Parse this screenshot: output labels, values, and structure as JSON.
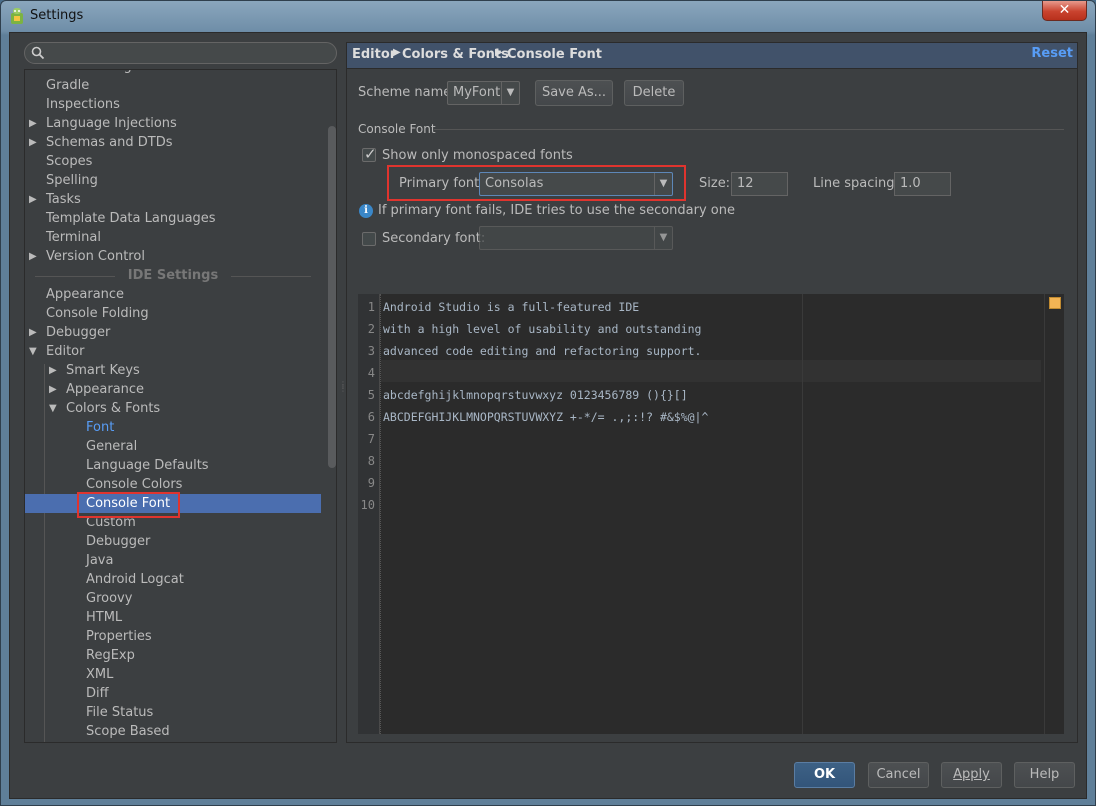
{
  "window": {
    "title": "Settings",
    "close_glyph": "✕"
  },
  "search": {
    "placeholder": ""
  },
  "tree": {
    "items": [
      {
        "label": "File Encodings",
        "level": 1,
        "arrow": ""
      },
      {
        "label": "Gradle",
        "level": 1,
        "arrow": ""
      },
      {
        "label": "Inspections",
        "level": 1,
        "arrow": ""
      },
      {
        "label": "Language Injections",
        "level": 1,
        "arrow": "▶"
      },
      {
        "label": "Schemas and DTDs",
        "level": 1,
        "arrow": "▶"
      },
      {
        "label": "Scopes",
        "level": 1,
        "arrow": ""
      },
      {
        "label": "Spelling",
        "level": 1,
        "arrow": ""
      },
      {
        "label": "Tasks",
        "level": 1,
        "arrow": "▶"
      },
      {
        "label": "Template Data Languages",
        "level": 1,
        "arrow": ""
      },
      {
        "label": "Terminal",
        "level": 1,
        "arrow": ""
      },
      {
        "label": "Version Control",
        "level": 1,
        "arrow": "▶"
      }
    ],
    "ide_section_label": "IDE Settings",
    "ide_items": [
      {
        "label": "Appearance",
        "level": 1,
        "arrow": ""
      },
      {
        "label": "Console Folding",
        "level": 1,
        "arrow": ""
      },
      {
        "label": "Debugger",
        "level": 1,
        "arrow": "▶"
      },
      {
        "label": "Editor",
        "level": 1,
        "arrow": "▼"
      },
      {
        "label": "Smart Keys",
        "level": 2,
        "arrow": "▶"
      },
      {
        "label": "Appearance",
        "level": 2,
        "arrow": "▶"
      },
      {
        "label": "Colors & Fonts",
        "level": 2,
        "arrow": "▼"
      },
      {
        "label": "Font",
        "level": 3,
        "arrow": ""
      },
      {
        "label": "General",
        "level": 3,
        "arrow": ""
      },
      {
        "label": "Language Defaults",
        "level": 3,
        "arrow": ""
      },
      {
        "label": "Console Colors",
        "level": 3,
        "arrow": ""
      },
      {
        "label": "Console Font",
        "level": 3,
        "arrow": "",
        "selected": true
      },
      {
        "label": "Custom",
        "level": 3,
        "arrow": ""
      },
      {
        "label": "Debugger",
        "level": 3,
        "arrow": ""
      },
      {
        "label": "Java",
        "level": 3,
        "arrow": ""
      },
      {
        "label": "Android Logcat",
        "level": 3,
        "arrow": ""
      },
      {
        "label": "Groovy",
        "level": 3,
        "arrow": ""
      },
      {
        "label": "HTML",
        "level": 3,
        "arrow": ""
      },
      {
        "label": "Properties",
        "level": 3,
        "arrow": ""
      },
      {
        "label": "RegExp",
        "level": 3,
        "arrow": ""
      },
      {
        "label": "XML",
        "level": 3,
        "arrow": ""
      },
      {
        "label": "Diff",
        "level": 3,
        "arrow": ""
      },
      {
        "label": "File Status",
        "level": 3,
        "arrow": ""
      },
      {
        "label": "Scope Based",
        "level": 3,
        "arrow": ""
      }
    ]
  },
  "breadcrumb": {
    "items": [
      "Editor",
      "Colors & Fonts",
      "Console Font"
    ],
    "separator": "▶",
    "reset": "Reset"
  },
  "scheme": {
    "label": "Scheme name:",
    "value": "MyFont",
    "save_as": "Save As...",
    "delete": "Delete"
  },
  "console_font": {
    "group_label": "Console Font",
    "show_monospaced": "Show only monospaced fonts",
    "primary_label": "Primary font:",
    "primary_value": "Consolas",
    "size_label": "Size:",
    "size_value": "12",
    "spacing_label": "Line spacing:",
    "spacing_value": "1.0",
    "info_text": "If primary font fails, IDE tries to use the secondary one",
    "secondary_label": "Secondary font:",
    "secondary_value": ""
  },
  "preview": {
    "line_numbers": [
      "1",
      "2",
      "3",
      "4",
      "5",
      "6",
      "7",
      "8",
      "9",
      "10"
    ],
    "lines": [
      "Android Studio is a full-featured IDE",
      "with a high level of usability and outstanding",
      "advanced code editing and refactoring support.",
      "",
      "abcdefghijklmnopqrstuvwxyz 0123456789 (){}[]",
      "ABCDEFGHIJKLMNOPQRSTUVWXYZ +-*/= .,;:!? #&$%@|^"
    ]
  },
  "footer": {
    "ok": "OK",
    "cancel": "Cancel",
    "apply": "Apply",
    "help": "Help"
  },
  "colors": {
    "selection": "#4b6eaf",
    "link": "#589df6",
    "highlight": "#e0342e",
    "background": "#3c3f41"
  }
}
